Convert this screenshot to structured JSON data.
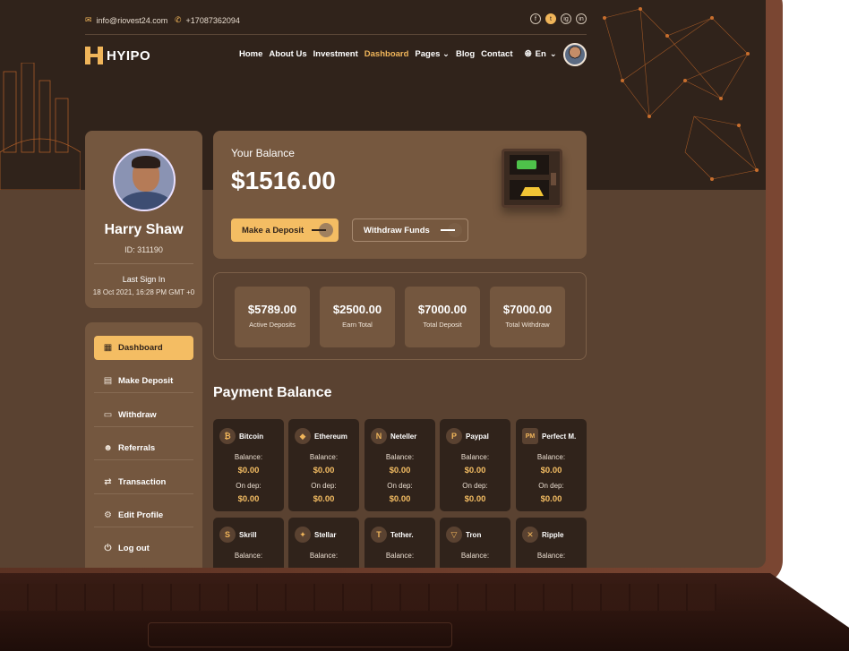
{
  "topbar": {
    "email": "info@riovest24.com",
    "phone": "+17087362094",
    "socials": [
      "f",
      "t",
      "ig",
      "in"
    ]
  },
  "brand": {
    "name": "HYIPO"
  },
  "nav": {
    "items": [
      "Home",
      "About Us",
      "Investment",
      "Dashboard",
      "Pages",
      "Blog",
      "Contact"
    ],
    "active": "Dashboard",
    "language": "En"
  },
  "profile": {
    "name": "Harry Shaw",
    "id": "ID: 311190",
    "last_signin_label": "Last Sign In",
    "last_signin_value": "18 Oct 2021, 16:28 PM GMT +0"
  },
  "sidebar": {
    "items": [
      {
        "label": "Dashboard",
        "icon": "dashboard-icon",
        "active": true
      },
      {
        "label": "Make Deposit",
        "icon": "receipt-icon"
      },
      {
        "label": "Withdraw",
        "icon": "withdraw-icon"
      },
      {
        "label": "Referrals",
        "icon": "users-icon"
      },
      {
        "label": "Transaction",
        "icon": "exchange-icon"
      },
      {
        "label": "Edit Profile",
        "icon": "user-gear-icon"
      },
      {
        "label": "Log out",
        "icon": "logout-icon"
      }
    ]
  },
  "balance": {
    "label": "Your Balance",
    "value": "$1516.00",
    "deposit_button": "Make a Deposit",
    "withdraw_button": "Withdraw Funds"
  },
  "stats": [
    {
      "value": "$5789.00",
      "label": "Active Deposits"
    },
    {
      "value": "$2500.00",
      "label": "Earn Total"
    },
    {
      "value": "$7000.00",
      "label": "Total Deposit"
    },
    {
      "value": "$7000.00",
      "label": "Total Withdraw"
    }
  ],
  "payment": {
    "title": "Payment Balance",
    "coins": [
      {
        "name": "Bitcoin",
        "glyph": "₿",
        "balance_label": "Balance:",
        "balance": "$0.00",
        "dep_label": "On dep:",
        "dep": "$0.00"
      },
      {
        "name": "Ethereum",
        "glyph": "◆",
        "balance_label": "Balance:",
        "balance": "$0.00",
        "dep_label": "On dep:",
        "dep": "$0.00"
      },
      {
        "name": "Neteller",
        "glyph": "N",
        "balance_label": "Balance:",
        "balance": "$0.00",
        "dep_label": "On dep:",
        "dep": "$0.00"
      },
      {
        "name": "Paypal",
        "glyph": "P",
        "balance_label": "Balance:",
        "balance": "$0.00",
        "dep_label": "On dep:",
        "dep": "$0.00"
      },
      {
        "name": "Perfect M.",
        "glyph": "PM",
        "balance_label": "Balance:",
        "balance": "$0.00",
        "dep_label": "On dep:",
        "dep": "$0.00"
      },
      {
        "name": "Skrill",
        "glyph": "S",
        "balance_label": "Balance:"
      },
      {
        "name": "Stellar",
        "glyph": "✦",
        "balance_label": "Balance:"
      },
      {
        "name": "Tether.",
        "glyph": "T",
        "balance_label": "Balance:"
      },
      {
        "name": "Tron",
        "glyph": "▽",
        "balance_label": "Balance:"
      },
      {
        "name": "Ripple",
        "glyph": "✕",
        "balance_label": "Balance:"
      }
    ]
  },
  "colors": {
    "accent": "#f4bd63",
    "panel": "#74573f",
    "dark": "#30231b"
  }
}
